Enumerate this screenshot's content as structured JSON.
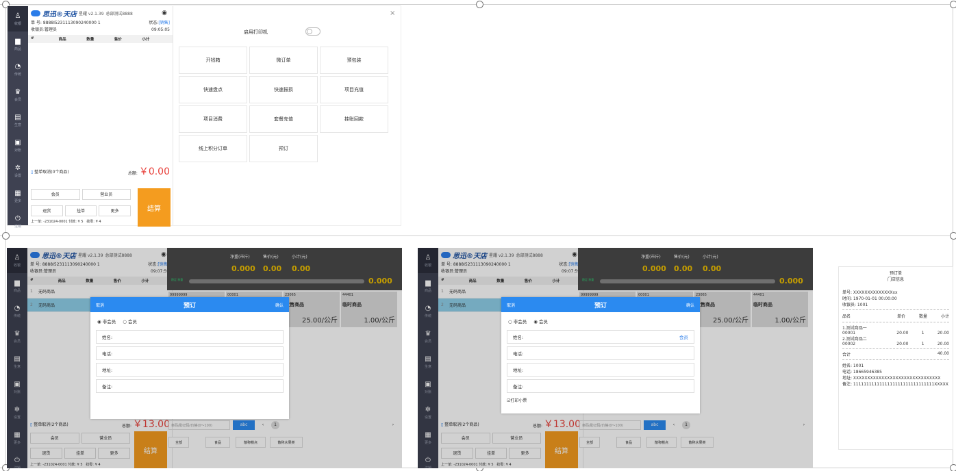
{
  "brand": {
    "name": "思迅®天店",
    "version": "星耀 v2.1.39",
    "store": "总部测试8888"
  },
  "sidebar": [
    {
      "icon": "♙",
      "label": "收银"
    },
    {
      "icon": "▆",
      "label": "商品"
    },
    {
      "icon": "◔",
      "label": "传统"
    },
    {
      "icon": "♛",
      "label": "会员"
    },
    {
      "icon": "▤",
      "label": "生意"
    },
    {
      "icon": "▣",
      "label": "对账"
    },
    {
      "icon": "✲",
      "label": "设置"
    },
    {
      "icon": "▦",
      "label": "更多"
    },
    {
      "icon": "⏻",
      "label": "注销"
    }
  ],
  "panel1": {
    "order_label": "单 号:",
    "order_no": "8888I5231113090240000 1",
    "status_label": "状态:",
    "status": "[销售]",
    "cashier_label": "收银员:",
    "cashier": "管理员",
    "time": "09:05:05",
    "cols": [
      "#",
      "商品",
      "数量",
      "售价",
      "小计"
    ],
    "cancel_all": "整单取消(0个商品)",
    "total_label": "总额:",
    "total": "￥0.00",
    "buttons": [
      "会员",
      "营业员",
      "退货",
      "挂单",
      "更多"
    ],
    "checkout": "结算",
    "footer": "上一单: -231024-0001 付款: ¥ 5",
    "change": "找零: ¥ 4",
    "close": "×",
    "printer_label": "启用打印机",
    "printer_on": false,
    "functions": [
      "开钱箱",
      "微订单",
      "预包装",
      "快速盘点",
      "快速报损",
      "项目充值",
      "项目消费",
      "套餐充值",
      "挂账回款",
      "线上积分订单",
      "预订"
    ]
  },
  "panel2": {
    "time": "09:07:59",
    "hdr": [
      "净重(市斤)",
      "售价(元)",
      "小计(元)"
    ],
    "vals": [
      "0.000",
      "0.00",
      "0.00"
    ],
    "net": "0.000",
    "stable": "稳定 称重",
    "items": [
      {
        "n": "1",
        "name": "无码商品"
      },
      {
        "n": "2",
        "name": "无码商品"
      }
    ],
    "products": [
      {
        "code": "99999999",
        "name": "",
        "price": ""
      },
      {
        "code": "00001",
        "name": "",
        "price": ""
      },
      {
        "code": "23065",
        "name": "散售商品",
        "price": "25.00/公斤"
      },
      {
        "code": "44401",
        "name": "临时商品",
        "price": "1.00/公斤"
      }
    ],
    "cancel_all": "整单取消(2个商品)",
    "total": "￥13.00",
    "search_placeholder": "条码/助记码/价格(0～100)",
    "abc": "abc",
    "page": "1",
    "tabs": [
      "全部",
      "食品",
      "散称糕点",
      "散称水果类"
    ],
    "modal": {
      "cancel": "取消",
      "title": "预订",
      "confirm": "确认",
      "radio1": "非会员",
      "radio2": "会员",
      "fields": [
        "姓名:",
        "电话:",
        "地址:",
        "备注:"
      ],
      "member_link": "会员",
      "print_receipt": "打印小票"
    }
  },
  "receipt": {
    "title": "预订单",
    "store": "门店信息",
    "order": "单号: XXXXXXXXXXXXXXxx",
    "time": "时间: 1970-01-01 00:00:00",
    "cashier": "收银员: 1001",
    "cols": [
      "品名",
      "单价",
      "数量",
      "小计"
    ],
    "lines": [
      {
        "name": "1.测试商品一",
        "code": "00001",
        "price": "20.00",
        "qty": "1",
        "sub": "20.00"
      },
      {
        "name": "2.测试商品二",
        "code": "00002",
        "price": "20.00",
        "qty": "1",
        "sub": "20.00"
      }
    ],
    "total_label": "合计",
    "total": "40.00",
    "name": "姓名: 1001",
    "phone": "电话: 18665946385",
    "addr": "地址: XXXXXXXXXXXXXXXXXXXXXXXXXXXXXXX",
    "note": "备注: 1111111111111111111111111111111XXXXX"
  }
}
